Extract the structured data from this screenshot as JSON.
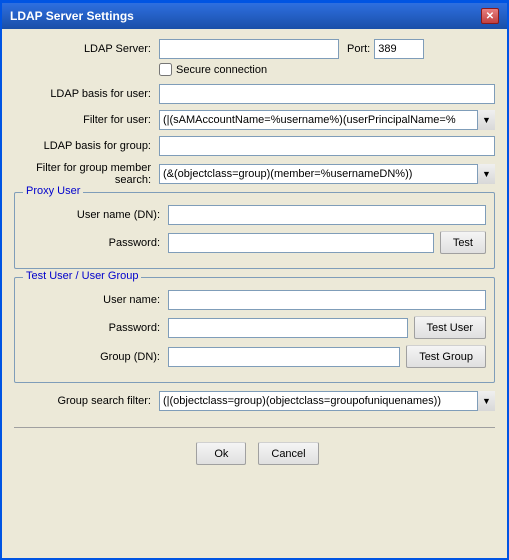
{
  "window": {
    "title": "LDAP Server Settings",
    "close_label": "✕"
  },
  "form": {
    "ldap_server_label": "LDAP Server:",
    "ldap_server_value": "",
    "port_label": "Port:",
    "port_value": "389",
    "secure_label": "Secure connection",
    "secure_checked": false,
    "ldap_basis_user_label": "LDAP basis for user:",
    "ldap_basis_user_value": "",
    "filter_user_label": "Filter for user:",
    "filter_user_value": "(|(sAMAccountName=%username%)(userPrincipalName=%",
    "ldap_basis_group_label": "LDAP basis for group:",
    "ldap_basis_group_value": "",
    "filter_group_label": "Filter for group member search:",
    "filter_group_value": "(&(objectclass=group)(member=%usernameDN%))"
  },
  "proxy_user": {
    "section_title": "Proxy User",
    "username_label": "User name (DN):",
    "username_value": "",
    "password_label": "Password:",
    "password_value": "",
    "test_button": "Test"
  },
  "test_user_group": {
    "section_title": "Test User / User Group",
    "username_label": "User name:",
    "username_value": "",
    "password_label": "Password:",
    "password_value": "",
    "test_user_button": "Test User",
    "group_label": "Group (DN):",
    "group_value": "",
    "test_group_button": "Test Group"
  },
  "group_search": {
    "label": "Group search filter:",
    "value": "(|(objectclass=group)(objectclass=groupofuniquenames))"
  },
  "buttons": {
    "ok_label": "Ok",
    "cancel_label": "Cancel"
  },
  "icons": {
    "dropdown_arrow": "▼",
    "close": "✕"
  }
}
